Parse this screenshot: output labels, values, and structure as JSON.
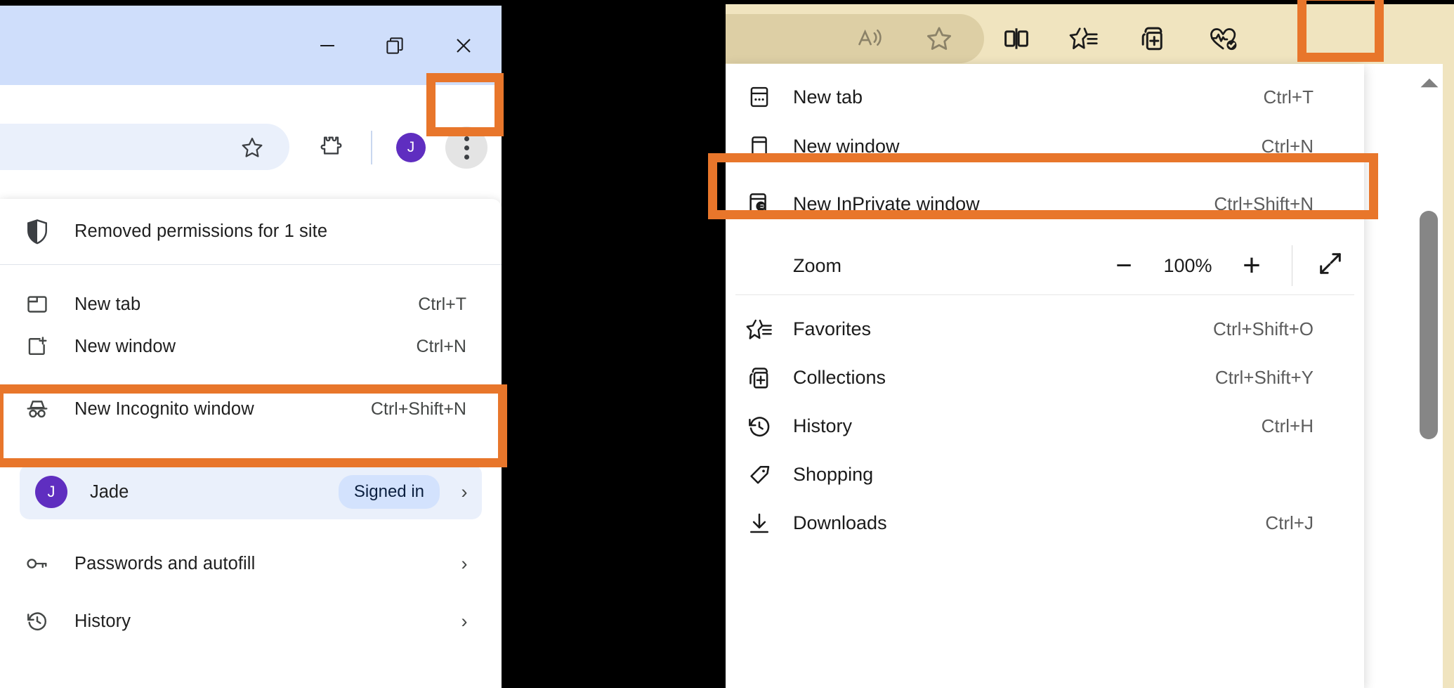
{
  "chrome": {
    "window_controls": [
      {
        "name": "minimize",
        "glyph": "–"
      },
      {
        "name": "restore",
        "glyph": "❐"
      },
      {
        "name": "close",
        "glyph": "✕"
      }
    ],
    "toolbar": {
      "bookmark_star": "bookmark-star-icon",
      "extensions": "extensions-puzzle-icon",
      "avatar_initial": "J",
      "kebab": "three-dot-menu-icon"
    },
    "menu": {
      "notice": {
        "label": "Removed permissions for 1 site",
        "icon": "shield-icon"
      },
      "items": [
        {
          "label": "New tab",
          "accel": "Ctrl+T",
          "icon": "new-tab-icon",
          "chevron": ""
        },
        {
          "label": "New window",
          "accel": "Ctrl+N",
          "icon": "new-window-icon",
          "chevron": ""
        },
        {
          "label": "New Incognito window",
          "accel": "Ctrl+Shift+N",
          "icon": "incognito-icon",
          "chevron": ""
        }
      ],
      "profile": {
        "avatar_initial": "J",
        "name": "Jade",
        "status": "Signed in",
        "chevron": "›"
      },
      "items_after": [
        {
          "label": "Passwords and autofill",
          "accel": "",
          "icon": "key-icon",
          "chevron": "›"
        },
        {
          "label": "History",
          "accel": "",
          "icon": "history-icon",
          "chevron": "›"
        }
      ]
    }
  },
  "edge": {
    "toolbar": {
      "read_aloud": "read-aloud-icon",
      "favorite_star": "favorite-star-icon",
      "split_screen": "split-screen-icon",
      "favorites": "favorites-list-icon",
      "collections": "collections-icon",
      "browser_essentials": "browser-essentials-icon",
      "more": "more-ellipsis-icon",
      "copilot": "copilot-icon"
    },
    "menu": {
      "items_top": [
        {
          "label": "New tab",
          "accel": "Ctrl+T",
          "icon": "new-tab-icon"
        },
        {
          "label": "New window",
          "accel": "Ctrl+N",
          "icon": "new-window-icon"
        },
        {
          "label": "New InPrivate window",
          "accel": "Ctrl+Shift+N",
          "icon": "inprivate-icon"
        }
      ],
      "zoom": {
        "label": "Zoom",
        "minus": "−",
        "value": "100%",
        "plus": "+",
        "fullscreen": "fullscreen-icon"
      },
      "items_bottom": [
        {
          "label": "Favorites",
          "accel": "Ctrl+Shift+O",
          "icon": "favorites-icon"
        },
        {
          "label": "Collections",
          "accel": "Ctrl+Shift+Y",
          "icon": "collections-icon"
        },
        {
          "label": "History",
          "accel": "Ctrl+H",
          "icon": "history-icon"
        },
        {
          "label": "Shopping",
          "accel": "",
          "icon": "shopping-tag-icon"
        },
        {
          "label": "Downloads",
          "accel": "Ctrl+J",
          "icon": "downloads-icon"
        }
      ]
    },
    "scrollbar": {
      "up_arrow": "scroll-up-arrow-icon"
    }
  },
  "annotations": {
    "highlight_color": "#e8762b",
    "boxes": [
      "chrome-kebab-button",
      "chrome-new-incognito-window-item",
      "edge-more-button",
      "edge-new-inprivate-window-item"
    ]
  }
}
